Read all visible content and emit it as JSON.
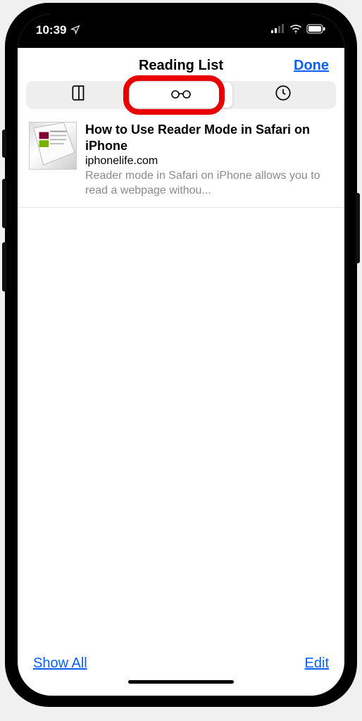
{
  "status": {
    "time": "10:39",
    "location_icon": "location-arrow-icon",
    "signal_bars": 3,
    "wifi": true,
    "battery": "full"
  },
  "header": {
    "title": "Reading List",
    "done": "Done"
  },
  "segments": {
    "items": [
      {
        "id": "bookmarks",
        "icon": "book-icon",
        "selected": false
      },
      {
        "id": "reading",
        "icon": "glasses-icon",
        "selected": true
      },
      {
        "id": "history",
        "icon": "clock-icon",
        "selected": false
      }
    ],
    "highlight_index": 1
  },
  "items": [
    {
      "title": "How to Use Reader Mode in Safari on iPhone",
      "domain": "iphonelife.com",
      "preview": "Reader mode in Safari on iPhone allows you to read a webpage withou..."
    }
  ],
  "toolbar": {
    "left": "Show All",
    "right": "Edit"
  },
  "colors": {
    "tint": "#0a60ff",
    "highlight": "#e80000"
  }
}
